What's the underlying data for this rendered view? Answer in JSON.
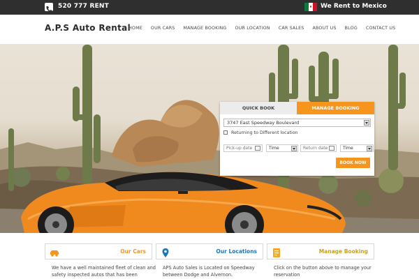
{
  "topbar": {
    "phone": "520 777 RENT",
    "mexico_text": "We Rent to Mexico",
    "phone_icon": "phone-icon",
    "flag_icon": "mexico-flag-icon"
  },
  "header": {
    "logo": "A.P.S Auto Rental",
    "nav": [
      "HOME",
      "OUR CARS",
      "MANAGE BOOKING",
      "OUR LOCATION",
      "CAR SALES",
      "ABOUT US",
      "BLOG",
      "CONTACT US"
    ]
  },
  "booking": {
    "tab_quick": "QUICK BOOK",
    "tab_manage": "MANAGE BOOKING",
    "location_value": "3747 East Speedway Boulevard",
    "return_label": "Returning to Different location",
    "pickup_placeholder": "Pick-up date",
    "pickup_time": "Time",
    "return_placeholder": "Return date",
    "return_time": "Time",
    "book_button": "BOOK NOW"
  },
  "features": [
    {
      "title": "Our Cars",
      "text": "We have a well maintained fleet of clean and safety inspected autos that has been",
      "icon": "car-icon",
      "color": "#f5951e"
    },
    {
      "title": "Our Locations",
      "text": "APS Auto Sales is Located on Speedway between Dodge and Alvernon.",
      "icon": "map-pin-icon",
      "color": "#1b76b8"
    },
    {
      "title": "Manage Booking",
      "text": "Click on the button above to manage your reservation",
      "icon": "booking-icon",
      "color": "#c9a11a"
    }
  ],
  "colors": {
    "accent": "#f5951e",
    "topbar": "#2f2f2f"
  }
}
